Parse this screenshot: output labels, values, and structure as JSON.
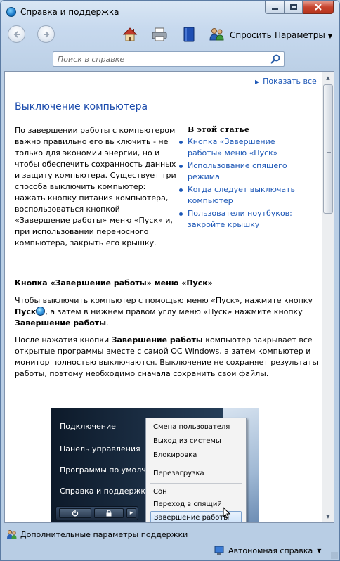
{
  "window": {
    "title": "Справка и поддержка"
  },
  "toolbar": {
    "ask_label": "Спросить",
    "options_label": "Параметры"
  },
  "search": {
    "placeholder": "Поиск в справке"
  },
  "content": {
    "show_all": "Показать все",
    "title": "Выключение компьютера",
    "intro": "По завершении работы с компьютером важно правильно его выключить - не только для экономии энергии, но и чтобы обеспечить сохранность данных и защиту компьютера. Существует три способа выключить компьютер: нажать кнопку питания компьютера, воспользоваться кнопкой «Завершение работы» меню «Пуск» и, при использовании переносного компьютера, закрыть его крышку.",
    "toc_heading": "В этой статье",
    "toc": [
      "Кнопка «Завершение работы» меню «Пуск»",
      "Использование спящего режима",
      "Когда следует выключать компьютер",
      "Пользователи ноутбуков: закройте крышку"
    ],
    "section_title": "Кнопка «Завершение работы» меню «Пуск»",
    "para1_a": "Чтобы выключить компьютер с помощью меню «Пуск», нажмите кнопку ",
    "para1_start": "Пуск",
    "para1_b": ", а затем в нижнем правом углу меню «Пуск» нажмите кнопку ",
    "para1_btn": "Завершение работы",
    "para1_end": ".",
    "para2_a": "После нажатия кнопки ",
    "para2_btn": "Завершение работы",
    "para2_b": " компьютер закрывает все открытые программы вместе с самой ОС Windows, а затем компьютер и монитор полностью выключаются. Выключение не сохраняет результаты работы, поэтому необходимо сначала сохранить свои файлы."
  },
  "screenshot": {
    "left_items": [
      "Подключение",
      "Панель управления",
      "Программы по умолч",
      "Справка и поддержка"
    ],
    "submenu": [
      "Смена пользователя",
      "Выход из системы",
      "Блокировка",
      "Перезагрузка",
      "Сон",
      "Переход в спящий режим",
      "Завершение работы"
    ],
    "arrow": "▸"
  },
  "footer": {
    "more_support": "Дополнительные параметры поддержки",
    "offline_help": "Автономная справка"
  }
}
